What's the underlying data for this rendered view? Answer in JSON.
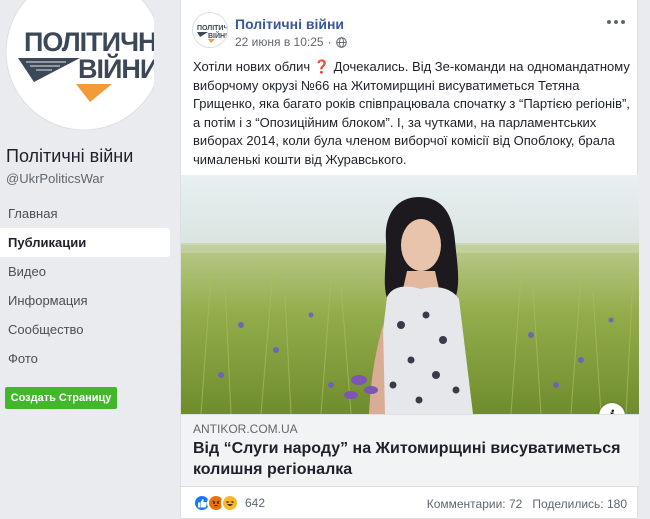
{
  "page": {
    "name": "Політичні війни",
    "handle": "@UkrPoliticsWar",
    "logo_text_line1": "ПОЛІТИЧНІ",
    "logo_text_line2": "ВІЙНИ"
  },
  "nav": {
    "items": [
      {
        "label": "Главная"
      },
      {
        "label": "Публикации",
        "active": true
      },
      {
        "label": "Видео"
      },
      {
        "label": "Информация"
      },
      {
        "label": "Сообщество"
      },
      {
        "label": "Фото"
      }
    ],
    "create_button": "Создать Страницу"
  },
  "post": {
    "author": "Політичні війни",
    "timestamp": "22 июня в 10:25",
    "separator": "·",
    "text_before_emoji": "Хотіли нових облич ",
    "emoji": "❓",
    "text_after_emoji": " Дочекались. Від Зе-команди на одномандатному виборчому окрузі №66 на Житомирщині висуватиметься Тетяна Грищенко, яка багато років співпрацювала спочатку з “Партією регіонів”, а потім і з “Опозиційним блоком”. І, за чутками, на парламентських виборах 2014, коли була членом виборчої комісії від Опоблоку, брала чималенькі кошти від Журавського.",
    "link": {
      "domain": "ANTIKOR.COM.UA",
      "title": "Від “Слуги народу” на Житомирщині висуватиметься колишня регіоналка",
      "info_icon": "i"
    },
    "reactions": {
      "icons": [
        "like-icon",
        "angry-icon",
        "haha-icon"
      ],
      "count": "642"
    },
    "comments": "Комментарии: 72",
    "shares": "Поделились: 180"
  },
  "colors": {
    "link_blue": "#385898",
    "create_green": "#42b72a",
    "background": "#e9ebee",
    "logo_orange": "#f29b38",
    "logo_dark": "#3c4858"
  }
}
